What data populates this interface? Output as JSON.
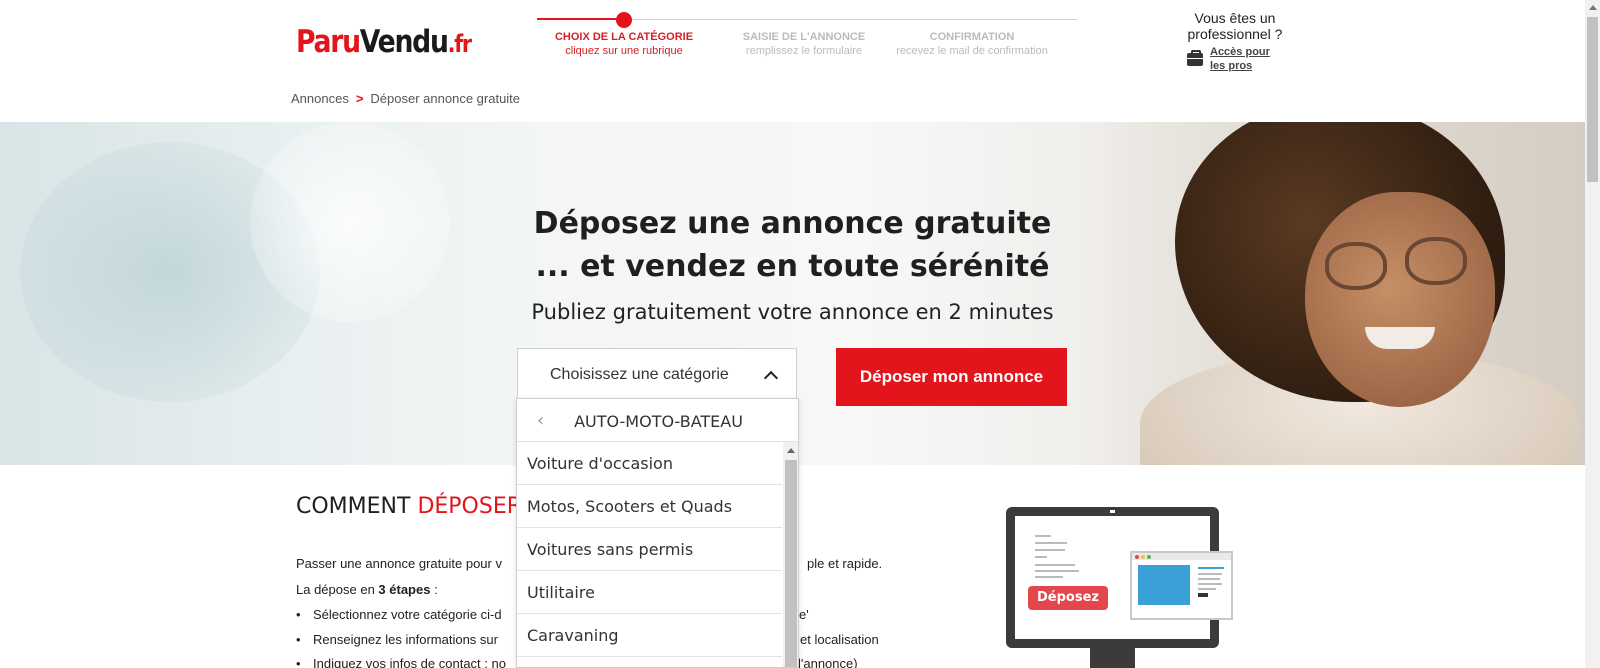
{
  "header": {
    "logo": {
      "part1": "Paru",
      "part2": "Vendu",
      "part3": ".fr"
    },
    "steps": [
      {
        "title": "CHOIX DE LA CATÉGORIE",
        "subtitle": "cliquez sur une rubrique",
        "active": true
      },
      {
        "title": "SAISIE DE L'ANNONCE",
        "subtitle": "remplissez le formulaire",
        "active": false
      },
      {
        "title": "CONFIRMATION",
        "subtitle": "recevez le mail de confirmation",
        "active": false
      }
    ],
    "pro": {
      "question": "Vous êtes un professionnel ?",
      "link": "Accès pour les pros",
      "icon": "briefcase-icon"
    }
  },
  "breadcrumb": {
    "root": "Annonces",
    "separator": ">",
    "current": "Déposer annonce gratuite"
  },
  "hero": {
    "title_line1": "Déposez une annonce gratuite",
    "title_line2": "... et vendez en toute sérénité",
    "subtitle": "Publiez gratuitement votre annonce en 2 minutes",
    "select_label": "Choisissez une catégorie",
    "cta": "Déposer mon annonce"
  },
  "dropdown": {
    "back_icon": "chevron-left-icon",
    "back_glyph": "‹",
    "category": "AUTO-MOTO-BATEAU",
    "items": [
      "Voiture d'occasion",
      "Motos, Scooters et Quads",
      "Voitures sans permis",
      "Utilitaire",
      "Caravaning"
    ]
  },
  "content": {
    "title_black": "COMMENT",
    "title_red": "DÉPOSER",
    "para1_start": "Passer une annonce gratuite pour v",
    "para1_end": "ple et rapide.",
    "para2_start": "La dépose en",
    "para2_bold": "3 étapes",
    "para2_end": ":",
    "bullets": [
      {
        "start": "Sélectionnez votre catégorie ci-d",
        "end": "e'"
      },
      {
        "start": "Renseignez les informations sur",
        "end": "et localisation"
      },
      {
        "start": "Indiquez vos infos de contact : no",
        "end": "l'annonce)"
      }
    ],
    "illustration_label": "Déposez"
  },
  "colors": {
    "brand_red": "#e3141b",
    "text": "#222222"
  }
}
